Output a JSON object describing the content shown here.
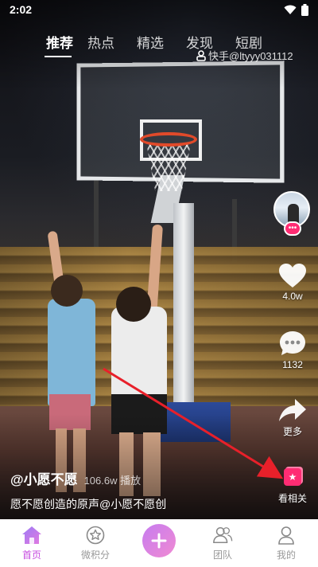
{
  "status_bar": {
    "time": "2:02"
  },
  "top_tabs": [
    {
      "label": "推荐",
      "active": true
    },
    {
      "label": "热点",
      "active": false
    },
    {
      "label": "精选",
      "active": false
    },
    {
      "label": "发现",
      "active": false
    },
    {
      "label": "短剧",
      "active": false
    }
  ],
  "watermark": {
    "text": "快手@ltyyy031112"
  },
  "actions": {
    "like_count": "4.0w",
    "comment_count": "1132",
    "more_label": "更多",
    "related_label": "看相关"
  },
  "caption": {
    "author": "@小愿不愿",
    "plays": "106.6w 播放",
    "description": "愿不愿创造的原声@小愿不愿创"
  },
  "bottom_nav": [
    {
      "label": "首页",
      "active": true,
      "icon": "home-icon"
    },
    {
      "label": "微积分",
      "active": false,
      "icon": "star-badge-icon"
    },
    {
      "label": "",
      "active": false,
      "icon": "plus-icon"
    },
    {
      "label": "团队",
      "active": false,
      "icon": "team-icon"
    },
    {
      "label": "我的",
      "active": false,
      "icon": "profile-icon"
    }
  ],
  "colors": {
    "accent": "#c74de0",
    "badge": "#ff2c73",
    "annotation_arrow": "#e8202a"
  }
}
